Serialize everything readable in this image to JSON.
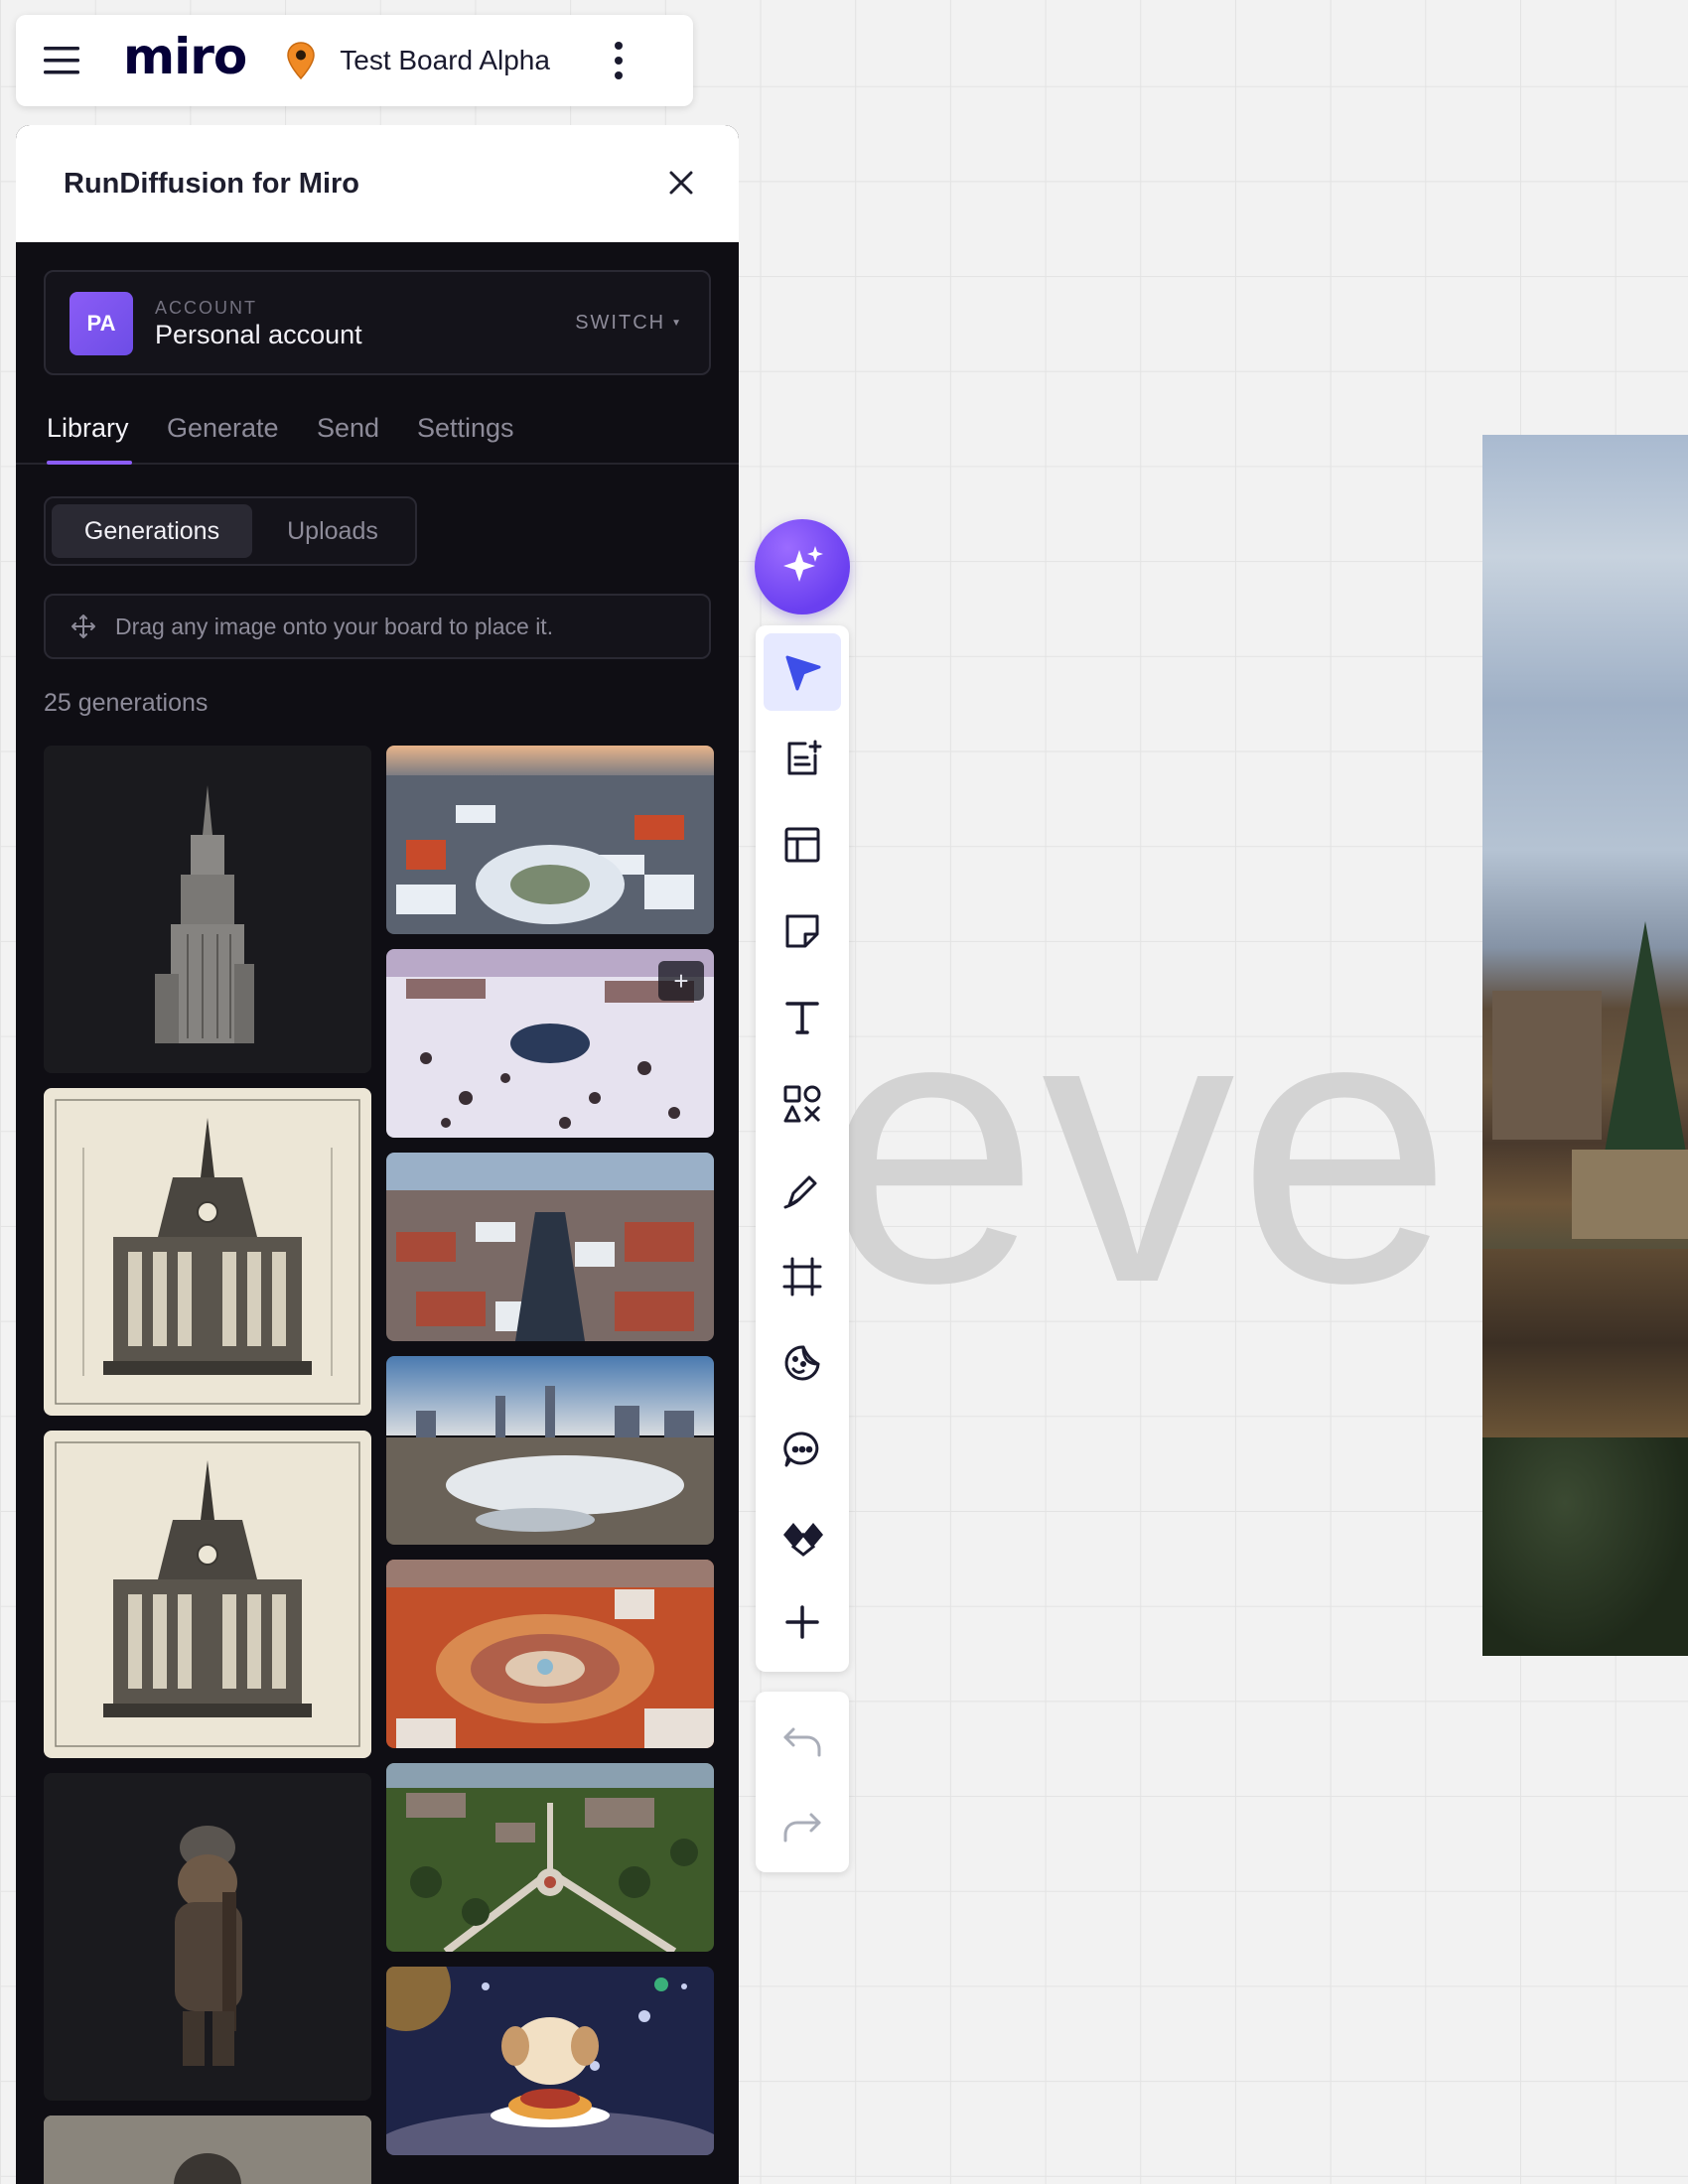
{
  "topbar": {
    "logo": "miro",
    "board_name": "Test Board Alpha",
    "icons": [
      "hamburger-menu-icon",
      "location-pin-icon",
      "more-vertical-icon"
    ],
    "pin_color": "#f08a24"
  },
  "panel": {
    "title": "RunDiffusion for Miro",
    "account": {
      "avatar_initials": "PA",
      "label": "ACCOUNT",
      "name": "Personal account",
      "switch_label": "SWITCH"
    },
    "tabs": [
      {
        "label": "Library",
        "active": true
      },
      {
        "label": "Generate",
        "active": false
      },
      {
        "label": "Send",
        "active": false
      },
      {
        "label": "Settings",
        "active": false
      }
    ],
    "segments": [
      {
        "label": "Generations",
        "active": true
      },
      {
        "label": "Uploads",
        "active": false
      }
    ],
    "hint": "Drag any image onto your board to place it.",
    "count": "25 generations",
    "accent_color": "#8b5cf6"
  },
  "canvas": {
    "text": "eve"
  },
  "toolbar": {
    "tools": [
      "select-cursor-icon",
      "smart-docs-icon",
      "templates-icon",
      "sticky-note-icon",
      "text-icon",
      "shapes-icon",
      "pen-icon",
      "frame-icon",
      "sticker-icon",
      "comment-icon",
      "apps-icon",
      "add-more-icon"
    ],
    "history": [
      "undo-icon",
      "redo-icon"
    ]
  }
}
